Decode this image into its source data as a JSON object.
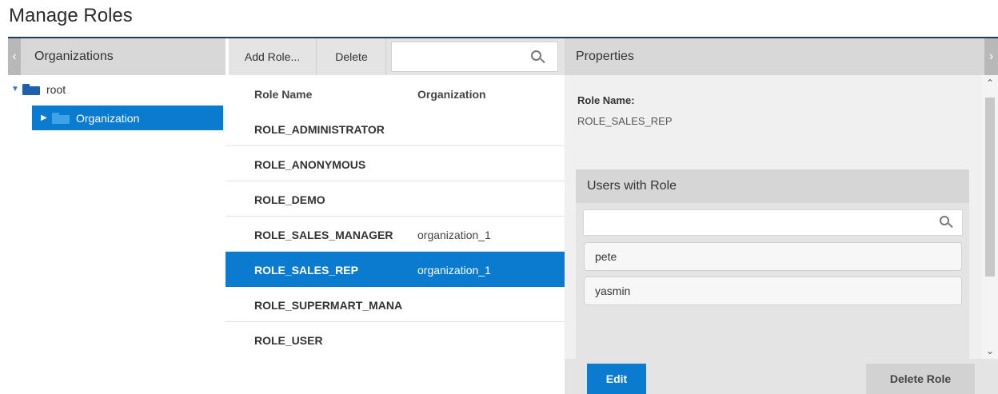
{
  "page": {
    "title": "Manage Roles"
  },
  "organizations": {
    "header": "Organizations",
    "collapse_glyph": "‹",
    "tree": {
      "root": {
        "label": "root",
        "expanded": true,
        "icon": "folder-icon"
      },
      "children": [
        {
          "label": "Organization",
          "selected": true,
          "icon": "folder-icon"
        }
      ]
    }
  },
  "roles": {
    "toolbar": {
      "add_label": "Add Role...",
      "delete_label": "Delete",
      "search_value": "",
      "search_icon": "search-icon"
    },
    "columns": [
      "Role Name",
      "Organization"
    ],
    "rows": [
      {
        "name": "ROLE_ADMINISTRATOR",
        "org": ""
      },
      {
        "name": "ROLE_ANONYMOUS",
        "org": ""
      },
      {
        "name": "ROLE_DEMO",
        "org": ""
      },
      {
        "name": "ROLE_SALES_MANAGER",
        "org": "organization_1"
      },
      {
        "name": "ROLE_SALES_REP",
        "org": "organization_1",
        "selected": true
      },
      {
        "name": "ROLE_SUPERMART_MANA",
        "org": ""
      },
      {
        "name": "ROLE_USER",
        "org": ""
      }
    ]
  },
  "properties": {
    "header": "Properties",
    "collapse_glyph": "›",
    "role_name_label": "Role Name:",
    "role_name_value": "ROLE_SALES_REP",
    "users": {
      "header": "Users with Role",
      "search_value": "",
      "items": [
        "pete",
        "yasmin"
      ]
    },
    "edit_label": "Edit",
    "delete_role_label": "Delete Role"
  },
  "colors": {
    "accent": "#0b7bd0",
    "header_bg": "#d8d8d8",
    "title_rule": "#1f3b64"
  }
}
